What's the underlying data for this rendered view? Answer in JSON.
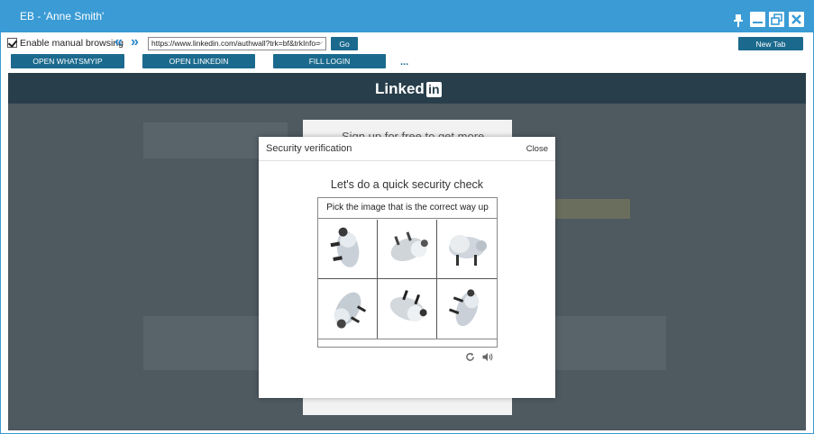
{
  "window": {
    "title": "EB - 'Anne Smith'"
  },
  "toolbar": {
    "manual_browsing_label": "Enable manual browsing",
    "manual_browsing_checked": true,
    "back_glyph": "«",
    "forward_glyph": "»",
    "url_value": "https://www.linkedin.com/authwall?trk=bf&trkInfo=",
    "go_label": "Go",
    "new_tab_label": "New Tab",
    "open_whatsmyip_label": "OPEN WHATSMYIP",
    "open_linkedin_label": "OPEN LINKEDIN",
    "fill_login_label": "FILL LOGIN",
    "more_label": "..."
  },
  "page": {
    "logo_text": "Linked",
    "logo_in": "in",
    "bg_card_text": "Sign up for free to get more"
  },
  "modal": {
    "title": "Security verification",
    "close_label": "Close",
    "heading": "Let's do a quick security check",
    "instruction": "Pick the image that is the correct way up",
    "tiles": [
      "bison-rotated",
      "bison-upside-down",
      "bison-upright",
      "bison-sideways",
      "bison-inverted",
      "bison-tilted"
    ]
  },
  "colors": {
    "titlebar": "#3a9bd5",
    "button": "#1b6a8e",
    "linkedin_header": "#283e4a"
  }
}
